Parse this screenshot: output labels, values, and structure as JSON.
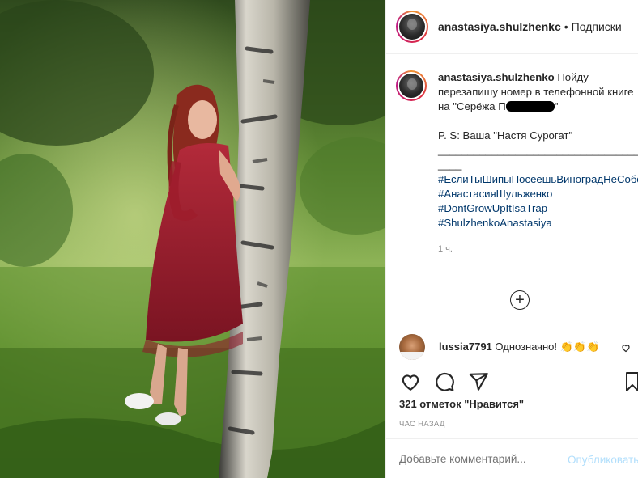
{
  "post": {
    "username": "anastasiya.shulzhenkc",
    "separator": "•",
    "follow_label": "Подписки",
    "more": "···"
  },
  "caption": {
    "username": "anastasiya.shulzhenko",
    "line1": "Пойду перезапишу номер в телефонной книге на \"Серёжа П",
    "line1_end": "\"",
    "ps": "P. S: Ваша \"Настя Сурогат\"",
    "divider": "______________________________________",
    "hashtags": [
      "#ЕслиТыШипыПосеешьВиноградНеСоберёшь",
      "#АнастасияШульженко",
      "#DontGrowUpItIsaTrap",
      "#ShulzhenkoAnastasiya"
    ],
    "time": "1 ч."
  },
  "comment": {
    "username": "lussia7791",
    "text": "Однозначно! 👏👏👏"
  },
  "likes": {
    "text": "321 отметок \"Нравится\""
  },
  "posted_time": "ЧАС НАЗАД",
  "comment_input": {
    "placeholder": "Добавьте комментарий...",
    "publish_label": "Опубликовать"
  },
  "icons": {
    "more_comments": "plus-circle-icon",
    "like": "heart-icon",
    "comment": "speech-bubble-icon",
    "share": "paper-plane-icon",
    "save": "bookmark-icon",
    "comment_like": "heart-small-icon"
  },
  "colors": {
    "hashtag": "#00376b",
    "muted": "#8e8e8e",
    "publish_disabled": "#b2dffc",
    "dress": "#9e1c2c"
  }
}
